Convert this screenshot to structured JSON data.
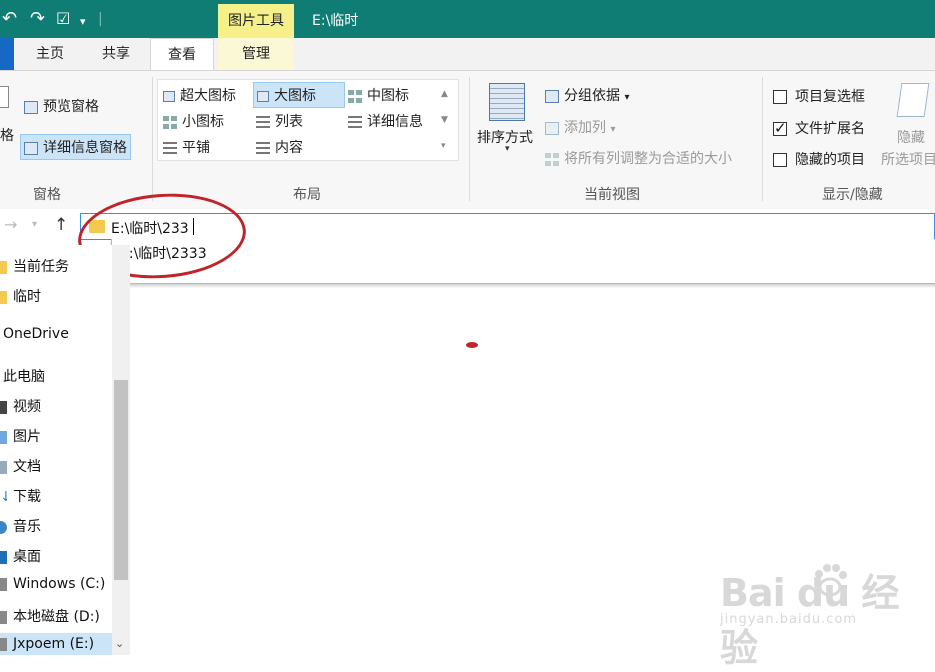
{
  "title_bar": {
    "picture_tools": "图片工具",
    "path": "E:\\临时"
  },
  "tabs": {
    "home": "主页",
    "share": "共享",
    "view": "查看",
    "manage": "管理"
  },
  "ribbon": {
    "panes": {
      "partial_label": "格",
      "preview_pane": "预览窗格",
      "details_pane": "详细信息窗格",
      "group_label": "窗格"
    },
    "layout": {
      "extra_large_icons": "超大图标",
      "large_icons": "大图标",
      "medium_icons": "中图标",
      "small_icons": "小图标",
      "list": "列表",
      "details": "详细信息",
      "tiles": "平铺",
      "content": "内容",
      "group_label": "布局"
    },
    "current_view": {
      "sort_by": "排序方式",
      "group_by": "分组依据",
      "add_columns": "添加列",
      "size_all_columns": "将所有列调整为合适的大小",
      "group_label": "当前视图"
    },
    "show_hide": {
      "item_check_boxes": "项目复选框",
      "file_name_extensions": "文件扩展名",
      "hidden_items": "隐藏的项目",
      "hide": "隐藏",
      "hide_selected": "所选项目",
      "group_label": "显示/隐藏",
      "checks": {
        "item_check_boxes": false,
        "file_name_extensions": true,
        "hidden_items": false
      }
    }
  },
  "address_bar": {
    "value": "E:\\临时\\233",
    "suggestion": "E:\\临时\\2333"
  },
  "sidebar": {
    "items": [
      "当前任务",
      "临时",
      "OneDrive",
      "此电脑",
      "视频",
      "图片",
      "文档",
      "下载",
      "音乐",
      "桌面",
      "Windows (C:)",
      "本地磁盘 (D:)",
      "Jxpoem (E:)"
    ]
  },
  "watermark": {
    "brand": "Bai  du 经验",
    "url": "jingyan.baidu.com"
  },
  "colors": {
    "title_bar": "#0f7d74",
    "picture_tools_tab": "#f6f08a",
    "annotation_red": "#c0242b",
    "address_focus": "#3a8ee6"
  }
}
